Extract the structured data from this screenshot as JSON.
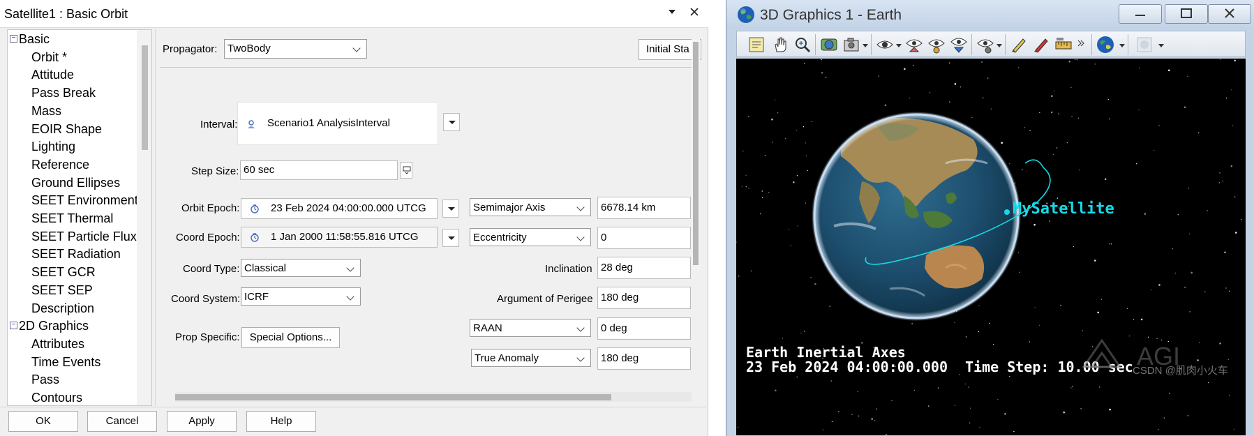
{
  "props_window": {
    "title": "Satellite1 : Basic Orbit",
    "tree": {
      "groups": [
        {
          "expander": "−",
          "label": "Basic",
          "items": [
            "Orbit *",
            "Attitude",
            "Pass Break",
            "Mass",
            "EOIR Shape",
            "Lighting",
            "Reference",
            "Ground Ellipses",
            "SEET Environment",
            "SEET Thermal",
            "SEET Particle Flux",
            "SEET Radiation",
            "SEET GCR",
            "SEET SEP",
            "Description"
          ]
        },
        {
          "expander": "−",
          "label": "2D Graphics",
          "items": [
            "Attributes",
            "Time Events",
            "Pass",
            "Contours"
          ]
        }
      ]
    },
    "form": {
      "propagator_label": "Propagator:",
      "propagator_value": "TwoBody",
      "initial_state_button": "Initial Sta",
      "interval_label": "Interval:",
      "interval_value": "Scenario1 AnalysisInterval",
      "step_size_label": "Step Size:",
      "step_size_value": "60 sec",
      "orbit_epoch_label": "Orbit Epoch:",
      "orbit_epoch_value": "23 Feb 2024 04:00:00.000 UTCG",
      "coord_epoch_label": "Coord Epoch:",
      "coord_epoch_value": "1 Jan 2000 11:58:55.816 UTCG",
      "coord_type_label": "Coord Type:",
      "coord_type_value": "Classical",
      "coord_system_label": "Coord System:",
      "coord_system_value": "ICRF",
      "prop_specific_label": "Prop Specific:",
      "special_options_button": "Special Options...",
      "elements": {
        "semimajor_axis_select": "Semimajor Axis",
        "semimajor_axis_value": "6678.14 km",
        "eccentricity_select": "Eccentricity",
        "eccentricity_value": "0",
        "inclination_label": "Inclination",
        "inclination_value": "28 deg",
        "arg_perigee_label": "Argument of Perigee",
        "arg_perigee_value": "180 deg",
        "raan_select": "RAAN",
        "raan_value": "0 deg",
        "true_anomaly_select": "True Anomaly",
        "true_anomaly_value": "180 deg"
      }
    },
    "buttons": {
      "ok": "OK",
      "cancel": "Cancel",
      "apply": "Apply",
      "help": "Help"
    }
  },
  "graphics_window": {
    "title": "3D Graphics 1 - Earth",
    "toolbar_icons": [
      "properties-icon",
      "pan-hand-icon",
      "zoom-icon",
      "globe-manager-icon",
      "snapshot-icon",
      "view-from-icon",
      "home-view-icon",
      "view-north-icon",
      "view-down-icon",
      "object-view-icon",
      "measure-pen-icon",
      "red-pen-icon",
      "ruler-icon",
      "more-icon",
      "earth-icon",
      "disabled-icon"
    ],
    "satellite_label": "MySatellite",
    "hud": {
      "axes": "Earth Inertial Axes",
      "time": "23 Feb 2024 04:00:00.000",
      "time_step": "Time Step: 10.00 sec"
    },
    "logo": "AGI",
    "watermark": "CSDN @肌肉小火车",
    "colors": {
      "orbit": "#17d9e6",
      "space": "#000000"
    }
  }
}
